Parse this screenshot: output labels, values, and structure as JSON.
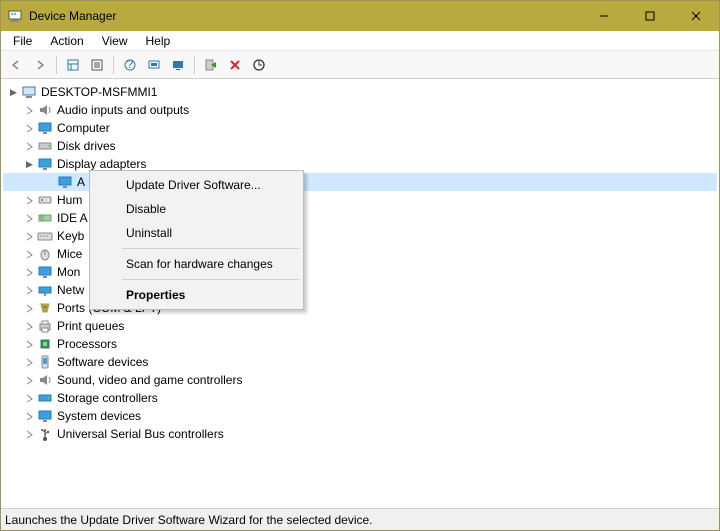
{
  "window": {
    "title": "Device Manager"
  },
  "menu": {
    "file": "File",
    "action": "Action",
    "view": "View",
    "help": "Help"
  },
  "tree": {
    "root": "DESKTOP-MSFMMI1",
    "items": [
      "Audio inputs and outputs",
      "Computer",
      "Disk drives",
      "Display adapters",
      "A",
      "Hum",
      "IDE A",
      "Keyb",
      "Mice",
      "Mon",
      "Netw",
      "Ports (COM & LPT)",
      "Print queues",
      "Processors",
      "Software devices",
      "Sound, video and game controllers",
      "Storage controllers",
      "System devices",
      "Universal Serial Bus controllers"
    ]
  },
  "context_menu": {
    "update": "Update Driver Software...",
    "disable": "Disable",
    "uninstall": "Uninstall",
    "scan": "Scan for hardware changes",
    "properties": "Properties"
  },
  "status": {
    "text": "Launches the Update Driver Software Wizard for the selected device."
  }
}
